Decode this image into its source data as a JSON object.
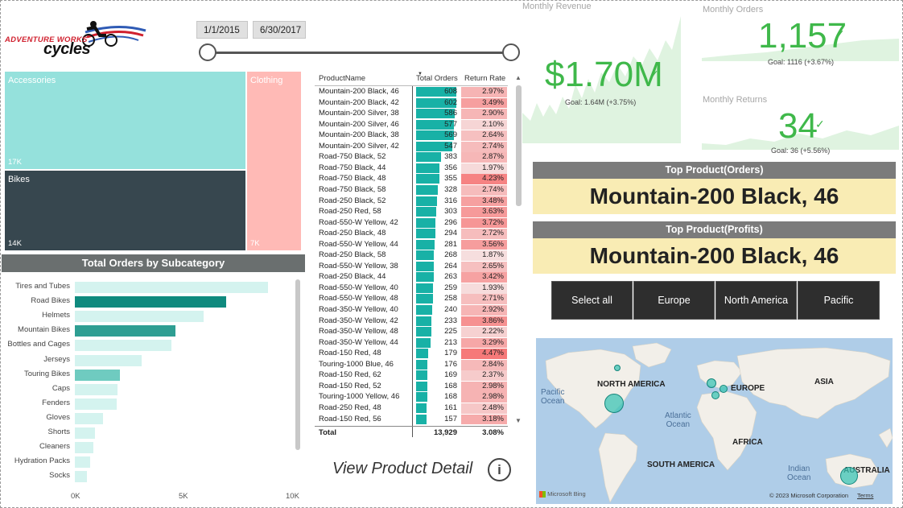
{
  "logo": {
    "line1": "ADVENTURE WORKS",
    "line2": "cycles"
  },
  "date_slicer": {
    "start": "1/1/2015",
    "end": "6/30/2017"
  },
  "treemap": [
    {
      "label": "Accessories",
      "value": "17K",
      "color": "#95e1dc"
    },
    {
      "label": "Bikes",
      "value": "14K",
      "color": "#37474f"
    },
    {
      "label": "Clothing",
      "value": "7K",
      "color": "#ffbab6"
    }
  ],
  "subcategory_chart": {
    "title": "Total  Orders by Subcategory",
    "chart_data": {
      "type": "bar",
      "orientation": "horizontal",
      "categories": [
        "Tires and Tubes",
        "Road Bikes",
        "Helmets",
        "Mountain Bikes",
        "Bottles and Cages",
        "Jerseys",
        "Touring Bikes",
        "Caps",
        "Fenders",
        "Gloves",
        "Shorts",
        "Cleaners",
        "Hydration Packs",
        "Socks"
      ],
      "values": [
        9000,
        7050,
        6000,
        4700,
        4500,
        3100,
        2100,
        2000,
        1950,
        1300,
        950,
        850,
        700,
        550
      ],
      "bar_colors": [
        "#d4f3ef",
        "#0f8a7e",
        "#d4f3ef",
        "#2e9e92",
        "#d4f3ef",
        "#d4f3ef",
        "#6fcbc0",
        "#d4f3ef",
        "#d4f3ef",
        "#d4f3ef",
        "#d4f3ef",
        "#d4f3ef",
        "#d4f3ef",
        "#d4f3ef"
      ],
      "xlim": [
        0,
        10000
      ],
      "xticks": [
        "0K",
        "5K",
        "10K"
      ]
    }
  },
  "product_table": {
    "headers": [
      "ProductName",
      "Total Orders",
      "Return Rate"
    ],
    "max_orders": 608,
    "rows": [
      [
        "Mountain-200 Black, 46",
        608,
        "2.97%",
        2.97
      ],
      [
        "Mountain-200 Black, 42",
        602,
        "3.49%",
        3.49
      ],
      [
        "Mountain-200 Silver, 38",
        586,
        "2.90%",
        2.9
      ],
      [
        "Mountain-200 Silver, 46",
        577,
        "2.10%",
        2.1
      ],
      [
        "Mountain-200 Black, 38",
        569,
        "2.64%",
        2.64
      ],
      [
        "Mountain-200 Silver, 42",
        547,
        "2.74%",
        2.74
      ],
      [
        "Road-750 Black, 52",
        383,
        "2.87%",
        2.87
      ],
      [
        "Road-750 Black, 44",
        356,
        "1.97%",
        1.97
      ],
      [
        "Road-750 Black, 48",
        355,
        "4.23%",
        4.23
      ],
      [
        "Road-750 Black, 58",
        328,
        "2.74%",
        2.74
      ],
      [
        "Road-250 Black, 52",
        316,
        "3.48%",
        3.48
      ],
      [
        "Road-250 Red, 58",
        303,
        "3.63%",
        3.63
      ],
      [
        "Road-550-W Yellow, 42",
        296,
        "3.72%",
        3.72
      ],
      [
        "Road-250 Black, 48",
        294,
        "2.72%",
        2.72
      ],
      [
        "Road-550-W Yellow, 44",
        281,
        "3.56%",
        3.56
      ],
      [
        "Road-250 Black, 58",
        268,
        "1.87%",
        1.87
      ],
      [
        "Road-550-W Yellow, 38",
        264,
        "2.65%",
        2.65
      ],
      [
        "Road-250 Black, 44",
        263,
        "3.42%",
        3.42
      ],
      [
        "Road-550-W Yellow, 40",
        259,
        "1.93%",
        1.93
      ],
      [
        "Road-550-W Yellow, 48",
        258,
        "2.71%",
        2.71
      ],
      [
        "Road-350-W Yellow, 40",
        240,
        "2.92%",
        2.92
      ],
      [
        "Road-350-W Yellow, 42",
        233,
        "3.86%",
        3.86
      ],
      [
        "Road-350-W Yellow, 48",
        225,
        "2.22%",
        2.22
      ],
      [
        "Road-350-W Yellow, 44",
        213,
        "3.29%",
        3.29
      ],
      [
        "Road-150 Red, 48",
        179,
        "4.47%",
        4.47
      ],
      [
        "Touring-1000 Blue, 46",
        176,
        "2.84%",
        2.84
      ],
      [
        "Road-150 Red, 62",
        169,
        "2.37%",
        2.37
      ],
      [
        "Road-150 Red, 52",
        168,
        "2.98%",
        2.98
      ],
      [
        "Touring-1000 Yellow, 46",
        168,
        "2.98%",
        2.98
      ],
      [
        "Road-250 Red, 48",
        161,
        "2.48%",
        2.48
      ],
      [
        "Road-150 Red, 56",
        157,
        "3.18%",
        3.18
      ]
    ],
    "total": {
      "label": "Total",
      "orders": "13,929",
      "rate": "3.08%"
    }
  },
  "view_detail": {
    "label": "View Product Detail",
    "info_icon": "i"
  },
  "kpis": {
    "revenue": {
      "title": "Monthly Revenue",
      "value": "$1.70M",
      "check": "✓",
      "goal": "Goal: 1.64M (+3.75%)"
    },
    "orders": {
      "title": "Monthly Orders",
      "value": "1,157",
      "check": "✓",
      "goal": "Goal: 1116 (+3.67%)"
    },
    "returns": {
      "title": "Monthly Returns",
      "value": "34",
      "check": "✓",
      "goal": "Goal: 36 (+5.56%)"
    }
  },
  "top_product_orders": {
    "header": "Top Product(Orders)",
    "value": "Mountain-200 Black, 46"
  },
  "top_product_profits": {
    "header": "Top Product(Profits)",
    "value": "Mountain-200 Black, 46"
  },
  "region_buttons": [
    "Select all",
    "Europe",
    "North America",
    "Pacific"
  ],
  "map": {
    "labels": {
      "na": "NORTH AMERICA",
      "eu": "EUROPE",
      "asia": "ASIA",
      "africa": "AFRICA",
      "sa": "SOUTH AMERICA",
      "au": "AUSTRALIA"
    },
    "oceans": {
      "pacific": "Pacific\nOcean",
      "atlantic": "Atlantic\nOcean",
      "indian": "Indian\nOcean"
    },
    "attribution": "© 2023 Microsoft Corporation",
    "terms": "Terms",
    "bing": "Microsoft Bing"
  },
  "colors": {
    "accent": "#18b1a6",
    "kpi_green": "#3fb84a",
    "header_gray": "#6a6f6f"
  }
}
